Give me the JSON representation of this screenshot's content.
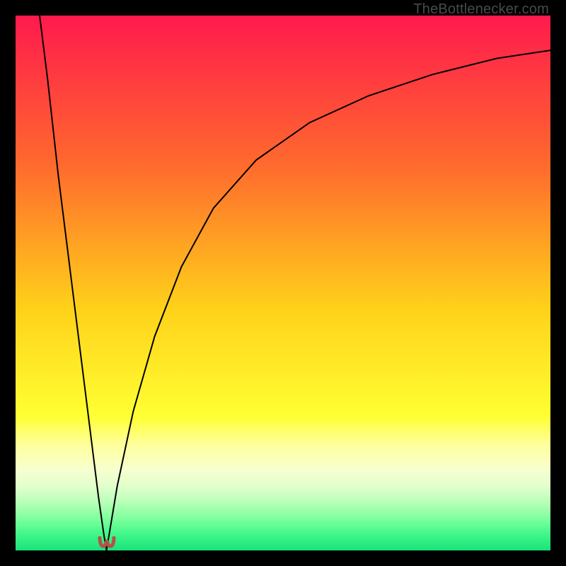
{
  "watermark": {
    "text": "TheBottlenecker.com"
  },
  "chart_data": {
    "type": "line",
    "title": "",
    "xlabel": "",
    "ylabel": "",
    "xlim": [
      0,
      100
    ],
    "ylim": [
      0,
      100
    ],
    "gradient_stops": [
      {
        "pct": 0,
        "color": "#ff1a4d"
      },
      {
        "pct": 28,
        "color": "#ff6a2d"
      },
      {
        "pct": 55,
        "color": "#ffd21a"
      },
      {
        "pct": 75,
        "color": "#ffff33"
      },
      {
        "pct": 80,
        "color": "#ffff99"
      },
      {
        "pct": 85,
        "color": "#f6ffd0"
      },
      {
        "pct": 88,
        "color": "#e2ffcc"
      },
      {
        "pct": 91,
        "color": "#b7ffb7"
      },
      {
        "pct": 94,
        "color": "#7fff9e"
      },
      {
        "pct": 97,
        "color": "#40f789"
      },
      {
        "pct": 100,
        "color": "#19e37a"
      }
    ],
    "curve": {
      "type": "abs-diff-over-ref",
      "minimum_x": 17,
      "points": [
        {
          "x": 4.5,
          "y": 100
        },
        {
          "x": 6,
          "y": 88
        },
        {
          "x": 8,
          "y": 70
        },
        {
          "x": 10,
          "y": 54
        },
        {
          "x": 12,
          "y": 38
        },
        {
          "x": 14,
          "y": 22
        },
        {
          "x": 15.5,
          "y": 10
        },
        {
          "x": 16.5,
          "y": 3
        },
        {
          "x": 17,
          "y": 0
        },
        {
          "x": 17.5,
          "y": 3
        },
        {
          "x": 19,
          "y": 12
        },
        {
          "x": 22,
          "y": 26
        },
        {
          "x": 26,
          "y": 40
        },
        {
          "x": 31,
          "y": 53
        },
        {
          "x": 37,
          "y": 64
        },
        {
          "x": 45,
          "y": 73
        },
        {
          "x": 55,
          "y": 80
        },
        {
          "x": 66,
          "y": 85
        },
        {
          "x": 78,
          "y": 89
        },
        {
          "x": 90,
          "y": 92
        },
        {
          "x": 100,
          "y": 93.5
        }
      ]
    },
    "marker": {
      "x": 17,
      "y": 1.5,
      "color": "#b74f4b",
      "shape": "u"
    }
  }
}
